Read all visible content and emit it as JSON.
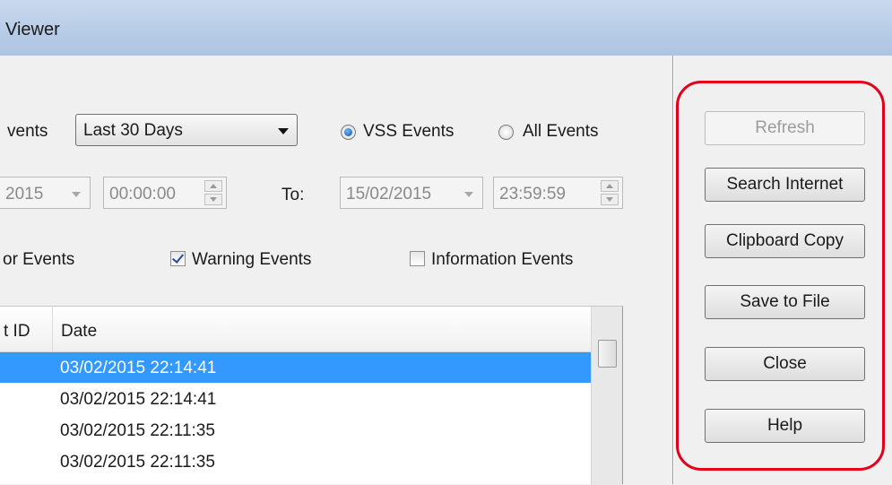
{
  "window": {
    "title": "Viewer"
  },
  "filters": {
    "events_label": "vents",
    "range_select": "Last 30 Days",
    "radio_vss": "VSS Events",
    "radio_all": "All Events",
    "from_date": "2015",
    "from_time": "00:00:00",
    "to_label": "To:",
    "to_date": "15/02/2015",
    "to_time": "23:59:59",
    "error_events": "or Events",
    "warning_events": "Warning Events",
    "information_events": "Information Events"
  },
  "table": {
    "columns": [
      "t ID",
      "Date"
    ],
    "rows": [
      "03/02/2015 22:14:41",
      "03/02/2015 22:14:41",
      "03/02/2015 22:11:35",
      "03/02/2015 22:11:35"
    ]
  },
  "buttons": {
    "refresh": "Refresh",
    "search_internet": "Search Internet",
    "clipboard_copy": "Clipboard Copy",
    "save_to_file": "Save to File",
    "close": "Close",
    "help": "Help"
  },
  "colors": {
    "selection": "#3399ff",
    "highlight_outline": "#e3001b",
    "title_bar": "#b6cbe6"
  }
}
